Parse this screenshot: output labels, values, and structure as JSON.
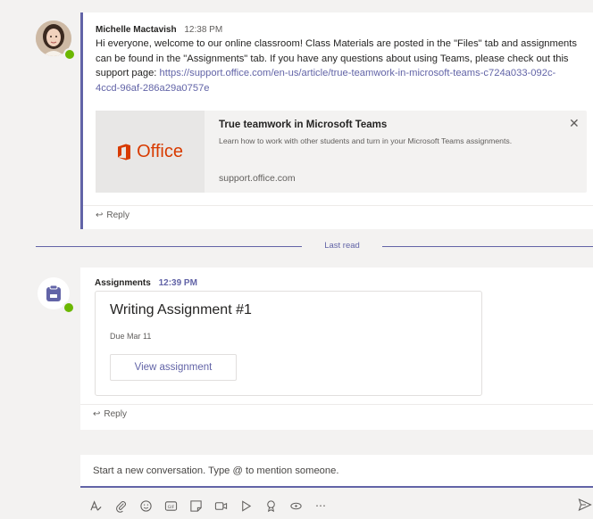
{
  "message1": {
    "author": "Michelle Mactavish",
    "time": "12:38 PM",
    "body_text": "Hi everyone, welcome to our online classroom! Class Materials are posted in the \"Files\" tab and assignments can be found in the \"Assignments\" tab. If you have any questions about using Teams, please check out this support page: ",
    "link_text": "https://support.office.com/en-us/article/true-teamwork-in-microsoft-teams-c724a033-092c-4ccd-96af-286a29a0757e",
    "card": {
      "logo_text": "Office",
      "title": "True teamwork in Microsoft Teams",
      "description": "Learn how to work with other students and turn in your Microsoft Teams assignments.",
      "domain": "support.office.com"
    },
    "reply_label": "Reply"
  },
  "last_read_label": "Last read",
  "message2": {
    "author": "Assignments",
    "time": "12:39 PM",
    "card": {
      "title": "Writing Assignment #1",
      "due": "Due Mar 11",
      "button_label": "View assignment"
    },
    "reply_label": "Reply"
  },
  "compose": {
    "placeholder": "Start a new conversation. Type @ to mention someone."
  },
  "toolbar": {
    "icons": [
      "format-icon",
      "attach-icon",
      "emoji-icon",
      "gif-icon",
      "sticker-icon",
      "meet-now-icon",
      "stream-icon",
      "praise-icon",
      "loop-icon",
      "more-options-icon",
      "send-icon"
    ]
  },
  "colors": {
    "accent": "#6264a7",
    "presence_available": "#6bb700",
    "office_orange": "#d83b01",
    "background": "#f3f2f1"
  }
}
